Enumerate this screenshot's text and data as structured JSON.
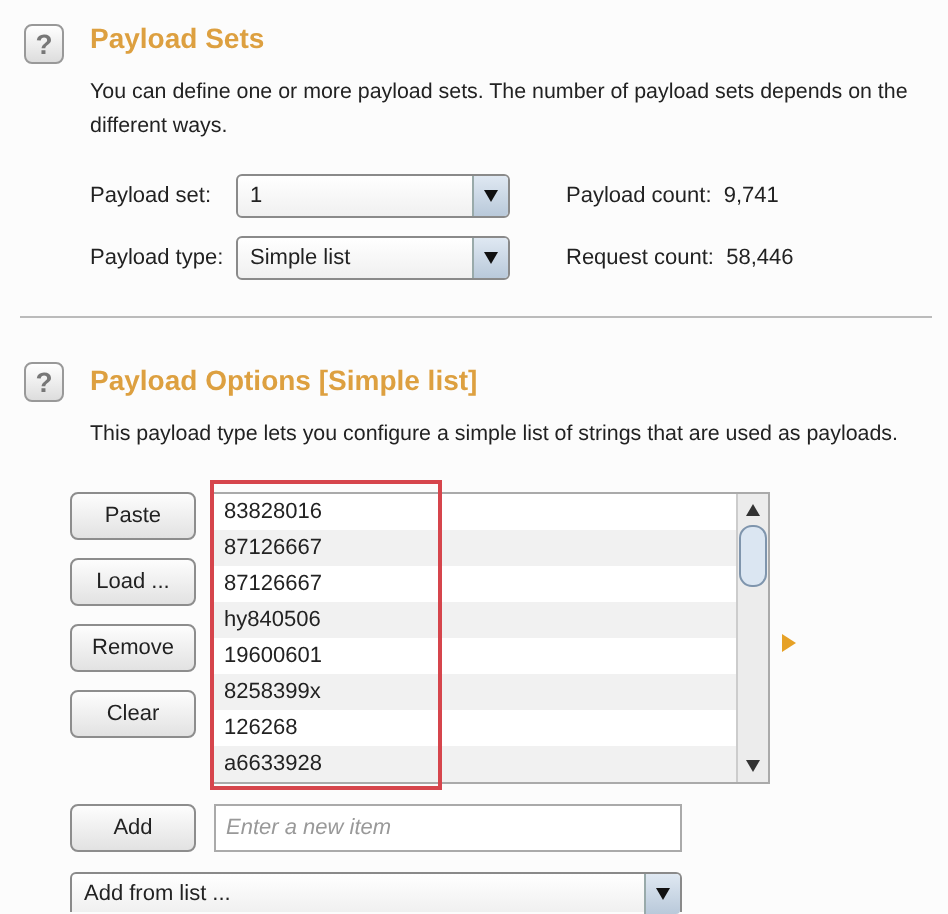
{
  "payload_sets": {
    "help": "?",
    "title": "Payload Sets",
    "description_lines": [
      "You can define one or more payload sets. The number of payload sets depends on the",
      "different ways."
    ],
    "rows": [
      {
        "label": "Payload set:",
        "value": "1",
        "info_label": "Payload count:",
        "info_value": "9,741"
      },
      {
        "label": "Payload type:",
        "value": "Simple list",
        "info_label": "Request count:",
        "info_value": "58,446"
      }
    ]
  },
  "payload_options": {
    "help": "?",
    "title": "Payload Options [Simple list]",
    "description": "This payload type lets you configure a simple list of strings that are used as payloads.",
    "buttons": [
      "Paste",
      "Load ...",
      "Remove",
      "Clear"
    ],
    "items": [
      "83828016",
      "87126667",
      "87126667",
      "hy840506",
      "19600601",
      "8258399x",
      "126268",
      "a6633928"
    ],
    "highlighted": true,
    "add_button": "Add",
    "new_item": {
      "placeholder": "Enter a new item"
    },
    "add_from_list": {
      "value": "Add from list ..."
    }
  }
}
